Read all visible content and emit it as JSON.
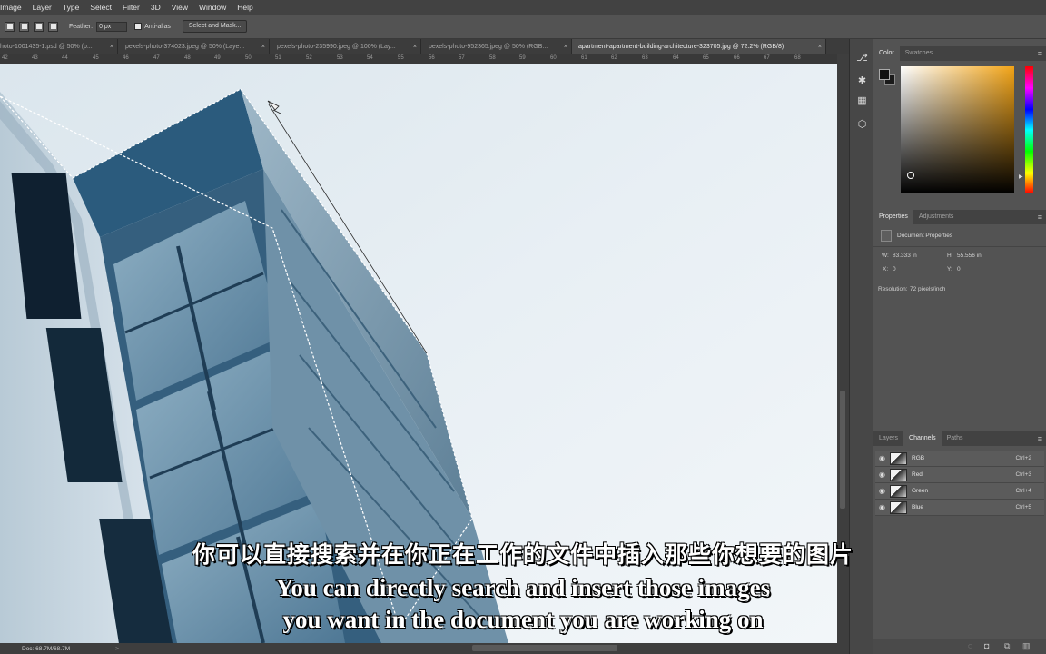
{
  "menu": [
    "Image",
    "Layer",
    "Type",
    "Select",
    "Filter",
    "3D",
    "View",
    "Window",
    "Help"
  ],
  "options": {
    "feather_label": "Feather:",
    "feather_value": "0 px",
    "antialias_label": "Anti-alias",
    "select_mask_label": "Select and Mask..."
  },
  "tabs": [
    {
      "label": "hoto-1001435-1.psd @ 50% (p...",
      "close": "×"
    },
    {
      "label": "pexels-photo-374023.jpeg @ 50% (Laye...",
      "close": "×"
    },
    {
      "label": "pexels-photo-235990.jpeg @ 100% (Lay...",
      "close": "×"
    },
    {
      "label": "pexels-photo-952365.jpeg @ 50% (RGB...",
      "close": "×"
    },
    {
      "label": "apartment-apartment-building-architecture-323705.jpg @ 72.2% (RGB/8)",
      "close": "×"
    }
  ],
  "ruler": [
    "42",
    "43",
    "44",
    "45",
    "46",
    "47",
    "48",
    "49",
    "50",
    "51",
    "52",
    "53",
    "54",
    "55",
    "56",
    "57",
    "58",
    "59",
    "60",
    "61",
    "62",
    "63",
    "64",
    "65",
    "66",
    "67",
    "68"
  ],
  "status": {
    "doc": "Doc: 68.7M/68.7M",
    "arrow": ">"
  },
  "color_panel": {
    "tabs": [
      "Color",
      "Swatches"
    ],
    "menu_icon": "≡"
  },
  "properties": {
    "tabs": [
      "Properties",
      "Adjustments"
    ],
    "menu_icon": "≡",
    "title": "Document Properties",
    "w_label": "W:",
    "w_value": "83.333 in",
    "h_label": "H:",
    "h_value": "55.556 in",
    "x_label": "X:",
    "x_value": "0",
    "y_label": "Y:",
    "y_value": "0",
    "resolution_label": "Resolution:",
    "resolution_value": "72 pixels/inch"
  },
  "channels_panel": {
    "tabs": [
      "Layers",
      "Channels",
      "Paths"
    ],
    "menu_icon": "≡",
    "rows": [
      {
        "name": "RGB",
        "shortcut": "Ctrl+2"
      },
      {
        "name": "Red",
        "shortcut": "Ctrl+3"
      },
      {
        "name": "Green",
        "shortcut": "Ctrl+4"
      },
      {
        "name": "Blue",
        "shortcut": "Ctrl+5"
      }
    ]
  },
  "subtitles": {
    "cn": "你可以直接搜索并在你正在工作的文件中插入那些你想要的图片",
    "en1": "You can directly search and insert those images",
    "en2": "you want in the document you are working on"
  }
}
